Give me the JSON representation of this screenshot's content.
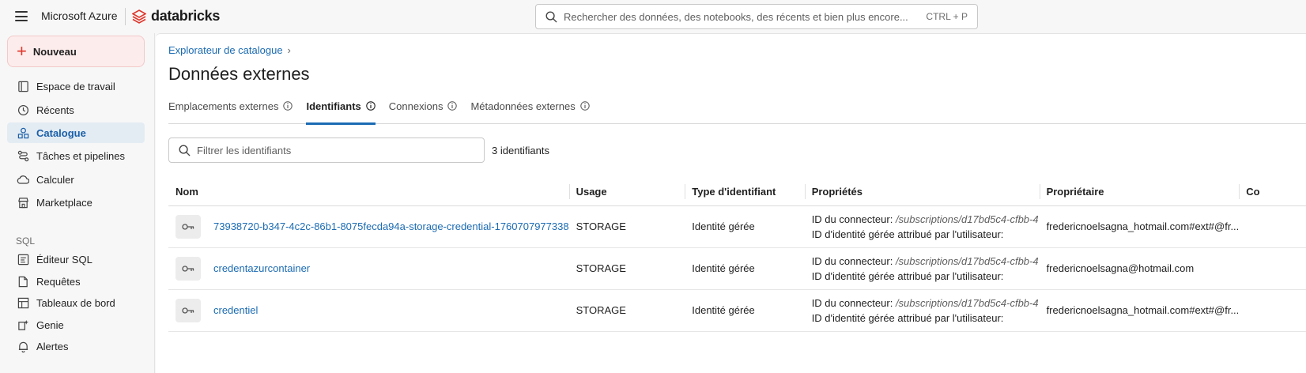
{
  "topbar": {
    "brand_microsoft": "Microsoft Azure",
    "brand_databricks": "databricks",
    "search_placeholder": "Rechercher des données, des notebooks, des récents et bien plus encore...",
    "search_shortcut": "CTRL + P"
  },
  "sidebar": {
    "new_label": "Nouveau",
    "items": [
      {
        "label": "Espace de travail",
        "icon": "workspace-icon"
      },
      {
        "label": "Récents",
        "icon": "clock-icon"
      },
      {
        "label": "Catalogue",
        "icon": "catalog-icon",
        "active": true
      },
      {
        "label": "Tâches et pipelines",
        "icon": "workflow-icon"
      },
      {
        "label": "Calculer",
        "icon": "cloud-icon"
      },
      {
        "label": "Marketplace",
        "icon": "store-icon"
      }
    ],
    "sql_label": "SQL",
    "sql_items": [
      {
        "label": "Éditeur SQL",
        "icon": "sql-editor-icon"
      },
      {
        "label": "Requêtes",
        "icon": "queries-icon"
      },
      {
        "label": "Tableaux de bord",
        "icon": "dashboard-icon"
      },
      {
        "label": "Genie",
        "icon": "genie-icon"
      },
      {
        "label": "Alertes",
        "icon": "bell-icon"
      }
    ]
  },
  "main": {
    "breadcrumb": "Explorateur de catalogue",
    "title": "Données externes",
    "tabs": [
      {
        "label": "Emplacements externes"
      },
      {
        "label": "Identifiants",
        "active": true
      },
      {
        "label": "Connexions"
      },
      {
        "label": "Métadonnées externes"
      }
    ],
    "filter_placeholder": "Filtrer les identifiants",
    "count_label": "3 identifiants",
    "table": {
      "headers": [
        "Nom",
        "Usage",
        "Type d'identifiant",
        "Propriétés",
        "Propriétaire",
        "Co"
      ],
      "rows": [
        {
          "name": "73938720-b347-4c2c-86b1-8075fecda94a-storage-credential-1760707977338",
          "usage": "STORAGE",
          "type": "Identité gérée",
          "prop_label1": "ID du connecteur:",
          "prop_path": "/subscriptions/d17bd5c4-cfbb-4",
          "prop_label2": "ID d'identité gérée attribué par l'utilisateur:",
          "owner": "fredericnoelsagna_hotmail.com#ext#@fr..."
        },
        {
          "name": "credentazurcontainer",
          "usage": "STORAGE",
          "type": "Identité gérée",
          "prop_label1": "ID du connecteur:",
          "prop_path": "/subscriptions/d17bd5c4-cfbb-4",
          "prop_label2": "ID d'identité gérée attribué par l'utilisateur:",
          "owner": "fredericnoelsagna@hotmail.com"
        },
        {
          "name": "credentiel",
          "usage": "STORAGE",
          "type": "Identité gérée",
          "prop_label1": "ID du connecteur:",
          "prop_path": "/subscriptions/d17bd5c4-cfbb-4",
          "prop_label2": "ID d'identité gérée attribué par l'utilisateur:",
          "owner": "fredericnoelsagna_hotmail.com#ext#@fr..."
        }
      ]
    }
  },
  "colors": {
    "accent": "#1b6bb3",
    "brand_red": "#e0362b",
    "active_bg": "#e4ecf3"
  }
}
